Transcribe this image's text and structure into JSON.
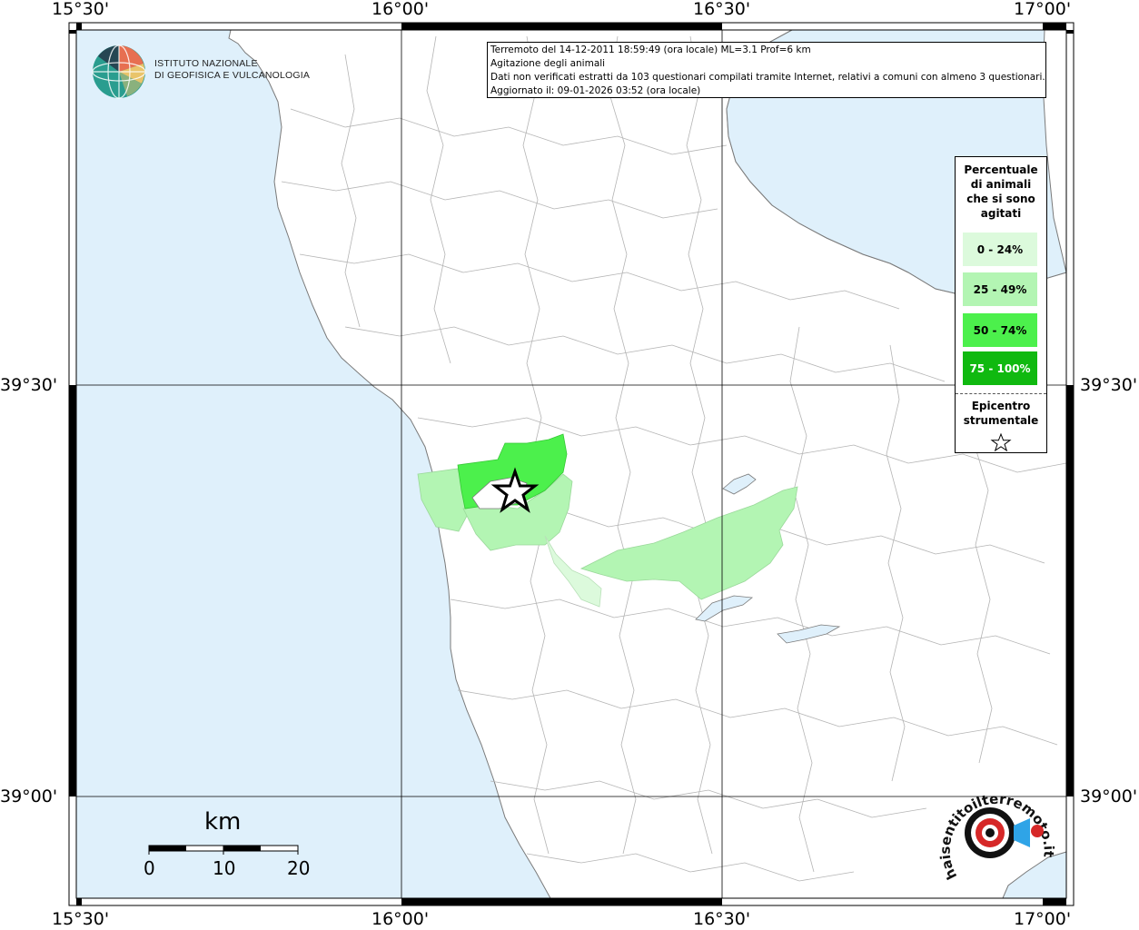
{
  "axes": {
    "top_labels": [
      "15°30'",
      "16°00'",
      "16°30'",
      "17°00'"
    ],
    "bottom_labels": [
      "15°30'",
      "16°00'",
      "16°30'",
      "17°00'"
    ],
    "left_labels": [
      "39°30'",
      "39°00'"
    ],
    "right_labels": [
      "39°30'",
      "39°00'"
    ]
  },
  "info": {
    "line1": "Terremoto del 14-12-2011 18:59:49 (ora locale) ML=3.1 Prof=6 km",
    "line2": "Agitazione degli animali",
    "line3": "Dati non verificati estratti da 103 questionari compilati tramite Internet, relativi a comuni con almeno 3 questionari.",
    "line4": "Aggiornato il: 09-01-2026 03:52 (ora locale)"
  },
  "logo": {
    "line1": "ISTITUTO NAZIONALE",
    "line2": "DI GEOFISICA E VULCANOLOGIA"
  },
  "legend": {
    "title_lines": [
      "Percentuale",
      "di animali",
      "che si sono",
      "agitati"
    ],
    "items": [
      {
        "label": "0 - 24%",
        "color": "#dcfadc",
        "text_color": "#000000"
      },
      {
        "label": "25 - 49%",
        "color": "#b3f5b3",
        "text_color": "#000000"
      },
      {
        "label": "50 - 74%",
        "color": "#4cf04c",
        "text_color": "#000000"
      },
      {
        "label": "75 - 100%",
        "color": "#10b910",
        "text_color": "#ffffff"
      }
    ],
    "epicenter_lines": [
      "Epicentro",
      "strumentale"
    ]
  },
  "scale": {
    "unit": "km",
    "ticks": [
      "0",
      "10",
      "20"
    ]
  },
  "colors": {
    "sea": "#dff0fb",
    "land": "#ffffff",
    "boundary": "#b4b4b4",
    "grid": "#000000"
  },
  "watermark": {
    "text": "haisentitoilterremoto.it"
  }
}
